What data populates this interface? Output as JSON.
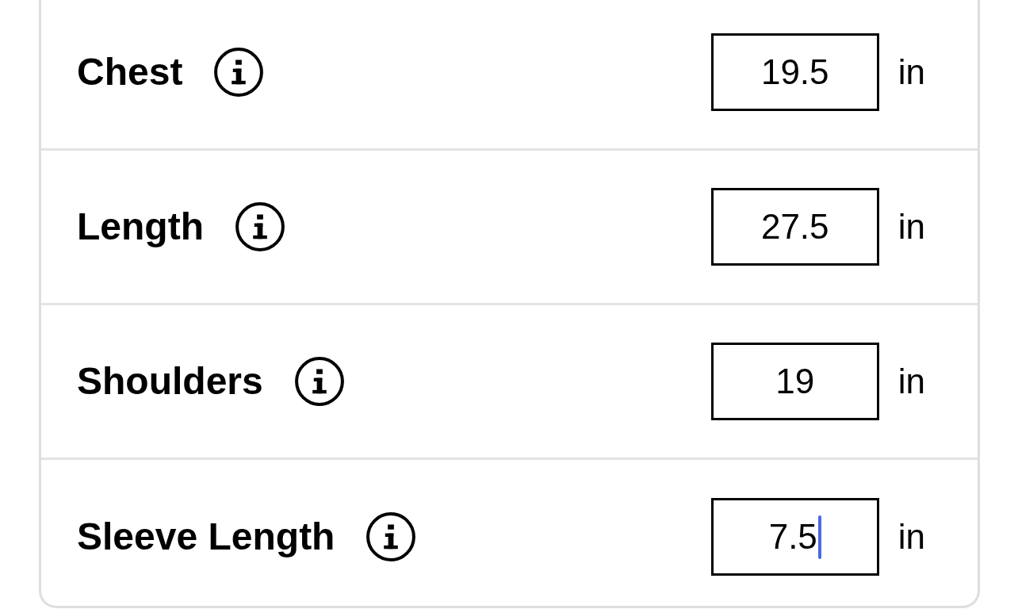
{
  "measurements": [
    {
      "label": "Chest",
      "value": "19.5",
      "unit": "in",
      "focused": false
    },
    {
      "label": "Length",
      "value": "27.5",
      "unit": "in",
      "focused": false
    },
    {
      "label": "Shoulders",
      "value": "19",
      "unit": "in",
      "focused": false
    },
    {
      "label": "Sleeve Length",
      "value": "7.5",
      "unit": "in",
      "focused": true
    }
  ]
}
